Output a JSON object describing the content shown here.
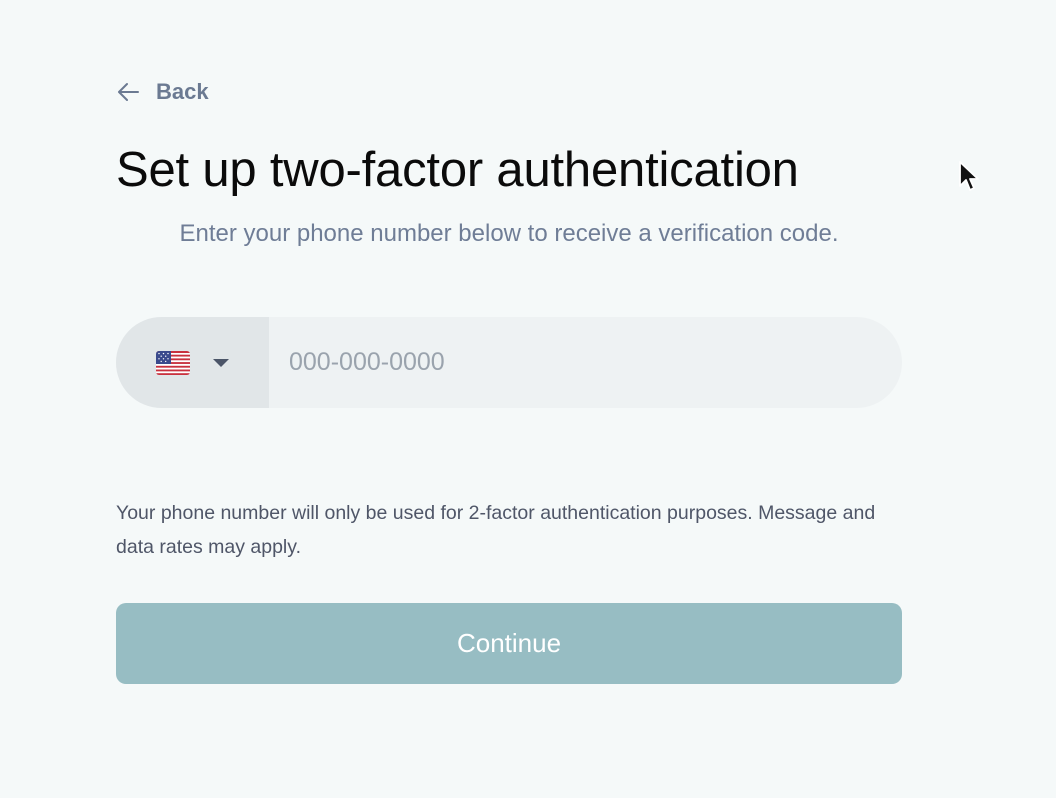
{
  "back": {
    "label": "Back",
    "icon": "arrow-left-icon"
  },
  "page": {
    "title": "Set up two-factor authentication",
    "subtitle": "Enter your phone number below to receive a verification code."
  },
  "phone": {
    "country_icon": "us-flag-icon",
    "dropdown_icon": "caret-down-icon",
    "value": "",
    "placeholder": "000-000-0000"
  },
  "disclaimer": "Your phone number will only be used for 2-factor authentication purposes. Message and data rates may apply.",
  "continue_label": "Continue",
  "colors": {
    "background": "#f5f9f9",
    "muted_text": "#6b7a92",
    "button": "#97bdc3",
    "field_bg": "#eef2f3",
    "country_bg": "#e1e6e8"
  }
}
